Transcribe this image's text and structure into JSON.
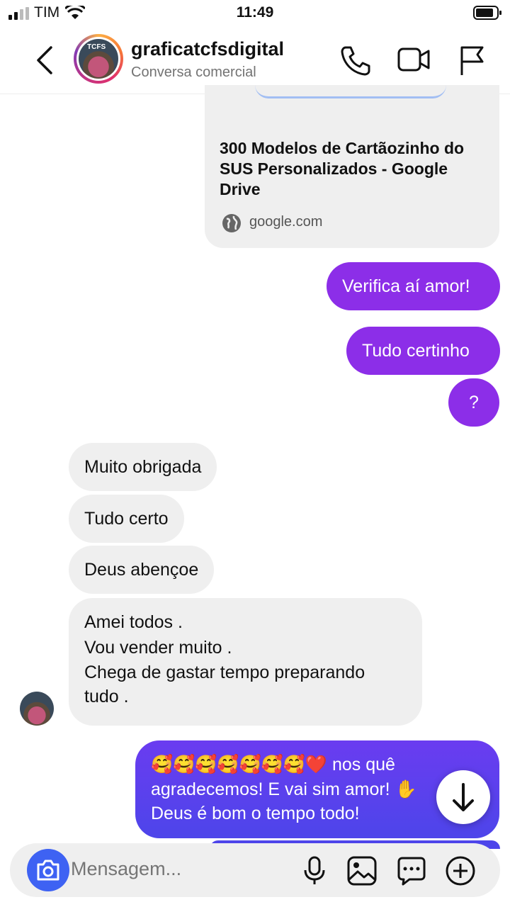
{
  "status_bar": {
    "carrier": "TIM",
    "time": "11:49"
  },
  "header": {
    "username": "graficatcfsdigital",
    "subtitle": "Conversa comercial",
    "avatar_text": "TCFS",
    "icons": [
      "back-icon",
      "phone-icon",
      "video-icon",
      "flag-icon"
    ]
  },
  "link_preview": {
    "title": "300 Modelos de Cartãozinho do SUS Personalizados - Google Drive",
    "domain": "google.com"
  },
  "messages": {
    "out1": "Verifica aí amor!",
    "out2": "Tudo certinho",
    "out3": "?",
    "in1": "Muito obrigada",
    "in2": "Tudo certo",
    "in3": "Deus abençoe",
    "in4_lines": [
      "Amei todos .",
      "Vou vender muito .",
      "Chega de gastar tempo preparando",
      "tudo ."
    ],
    "out4_emojis": "🥰🥰🥰🥰🥰🥰🥰❤️",
    "out4_text1": " nos quê",
    "out4_text2": "agradecemos! E vai sim amor! ✋",
    "out4_text3": "Deus é bom o tempo todo!"
  },
  "composer": {
    "placeholder": "Mensagem...",
    "icons": [
      "camera-icon",
      "mic-icon",
      "gallery-icon",
      "sticker-icon",
      "plus-icon"
    ]
  },
  "colors": {
    "outgoing": "#8c2ee8",
    "incoming": "#efefef",
    "camera": "#3e62f3"
  }
}
